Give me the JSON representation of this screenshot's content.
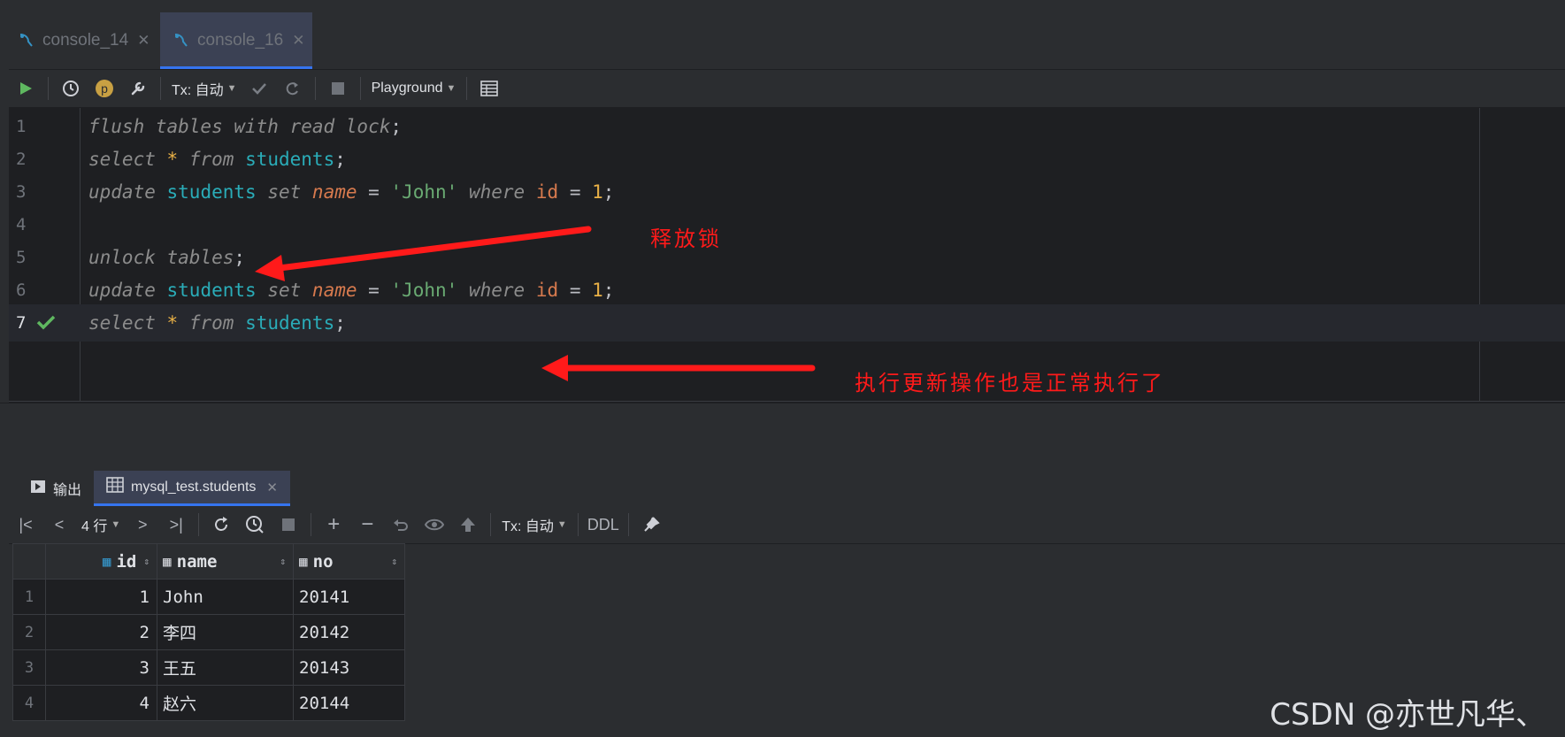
{
  "tabs": [
    {
      "label": "console_14",
      "close": "✕"
    },
    {
      "label": "console_16",
      "close": "✕"
    }
  ],
  "toolbar": {
    "tx_label": "Tx: 自动",
    "playground_label": "Playground",
    "p_badge": "p"
  },
  "editor": {
    "line_numbers": [
      "1",
      "2",
      "3",
      "4",
      "5",
      "6",
      "7"
    ]
  },
  "annotations": {
    "release_lock": "释放锁",
    "update_normal": "执行更新操作也是正常执行了"
  },
  "bottom_tabs": {
    "output_label": "输出",
    "table_tab_label": "mysql_test.students",
    "close": "✕"
  },
  "result_toolbar": {
    "rows_label": "4 行",
    "tx_label": "Tx: 自动",
    "ddl_label": "DDL"
  },
  "result_table": {
    "columns": [
      "id",
      "name",
      "no"
    ],
    "rows": [
      {
        "rn": "1",
        "id": "1",
        "name": "John",
        "no": "20141"
      },
      {
        "rn": "2",
        "id": "2",
        "name": "李四",
        "no": "20142"
      },
      {
        "rn": "3",
        "id": "3",
        "name": "王五",
        "no": "20143"
      },
      {
        "rn": "4",
        "id": "4",
        "name": "赵六",
        "no": "20144"
      }
    ]
  },
  "watermark": "CSDN @亦世凡华、",
  "colors": {
    "accent": "#3574f0",
    "annotation_red": "#ff1a1a",
    "run_green": "#5fb860"
  }
}
